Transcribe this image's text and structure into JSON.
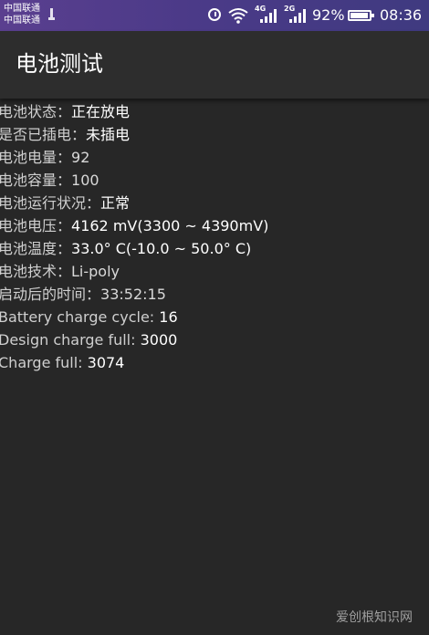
{
  "status_bar": {
    "carrier_1": "中国联通",
    "carrier_2": "中国联通",
    "network_1": "4G",
    "network_2": "2G",
    "battery_percent": "92%",
    "battery_level": 0.92,
    "time": "08:36",
    "icons": [
      "usb-icon",
      "alarm-icon",
      "wifi-icon",
      "signal-icon",
      "signal-icon",
      "battery-icon"
    ]
  },
  "app_bar": {
    "title": "电池测试"
  },
  "info_rows": [
    {
      "label": "电池状态：",
      "value": "正在放电"
    },
    {
      "label": "是否已插电：",
      "value": "未插电"
    },
    {
      "label": "电池电量：",
      "value": "92"
    },
    {
      "label": "电池容量：",
      "value": "100"
    },
    {
      "label": "电池运行状况：",
      "value": "正常"
    },
    {
      "label": "电池电压：",
      "value": "4162 mV(3300 ~ 4390mV)"
    },
    {
      "label": "电池温度：",
      "value": "33.0° C(-10.0 ~ 50.0° C)"
    },
    {
      "label": "电池技术：",
      "value": "Li-poly"
    },
    {
      "label": "启动后的时间：",
      "value": "33:52:15"
    },
    {
      "label": "Battery charge cycle: ",
      "value": "16"
    },
    {
      "label": "Design charge full: ",
      "value": "3000"
    },
    {
      "label": "Charge full: ",
      "value": "3074"
    }
  ],
  "watermark": "爱创根知识网",
  "colors": {
    "status_bar": "#4b3a88",
    "app_bar": "#2d2d2d",
    "background": "#272727",
    "text": "#e6e6e6"
  }
}
